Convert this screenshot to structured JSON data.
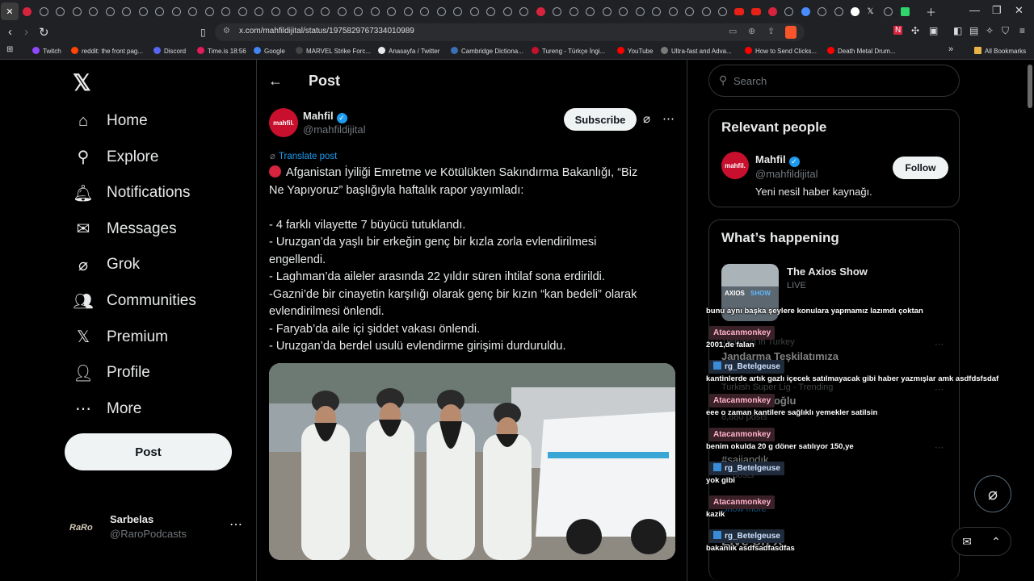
{
  "browser": {
    "url": "x.com/mahfildijital/status/1975829767334010989",
    "bookmarks": [
      "Twitch",
      "reddit: the front pag...",
      "Discord",
      "Time.is 18:56",
      "Google",
      "MARVEL Strike Forc...",
      "Anasayfa / Twitter",
      "Cambridge Dictiona...",
      "Tureng - Türkçe İngi...",
      "YouTube",
      "Ultra-fast and Adva...",
      "How to Send Clicks...",
      "Death Metal Drum..."
    ],
    "all_bookmarks": "All Bookmarks",
    "bookmark_colors": [
      "#9146ff",
      "#ff4500",
      "#5865f2",
      "#e41b5c",
      "#4285f4",
      "#444444",
      "#e7e9ea",
      "#3b6eb4",
      "#c8102e",
      "#ff0000",
      "#7a7a7a",
      "#ff0000",
      "#ff0000"
    ]
  },
  "nav": {
    "items": [
      {
        "label": "Home",
        "icon": "home-icon",
        "glyph": "⌂"
      },
      {
        "label": "Explore",
        "icon": "search-icon",
        "glyph": "⚲"
      },
      {
        "label": "Notifications",
        "icon": "bell-icon",
        "glyph": "🔔︎"
      },
      {
        "label": "Messages",
        "icon": "envelope-icon",
        "glyph": "✉"
      },
      {
        "label": "Grok",
        "icon": "grok-icon",
        "glyph": "⌀"
      },
      {
        "label": "Communities",
        "icon": "people-icon",
        "glyph": "👥︎"
      },
      {
        "label": "Premium",
        "icon": "x-icon",
        "glyph": "𝕏"
      },
      {
        "label": "Profile",
        "icon": "person-icon",
        "glyph": "👤︎"
      },
      {
        "label": "More",
        "icon": "more-circle-icon",
        "glyph": "⋯"
      }
    ],
    "post_button": "Post",
    "account": {
      "name": "Sarbelas",
      "handle": "@RaroPodcasts",
      "avatar_text": "RaRo"
    }
  },
  "main": {
    "title": "Post",
    "author": {
      "name": "Mahfil",
      "handle": "@mahfildijital",
      "avatar_text": "mahfil."
    },
    "subscribe": "Subscribe",
    "translate": "Translate post",
    "lines": [
      "Afganistan İyiliği Emretme ve Kötülükten Sakındırma Bakanlığı, “Biz",
      "Ne Yapıyoruz” başlığıyla haftalık rapor yayımladı:",
      "",
      "- 4 farklı vilayette 7 büyücü tutuklandı.",
      "- Uruzgan’da yaşlı bir erkeğin genç bir kızla zorla evlendirilmesi",
      "engellendi.",
      "- Laghman’da aileler arasında 22 yıldır süren ihtilaf sona erdirildi.",
      "-Gazni’de bir cinayetin karşılığı olarak genç bir kızın “kan bedeli” olarak",
      "evlendirilmesi önlendi.",
      "- Faryab’da aile içi şiddet vakası önlendi.",
      "- Uruzgan’da berdel usulü evlendirme girişimi durduruldu."
    ]
  },
  "right": {
    "search_placeholder": "Search",
    "relevant_title": "Relevant people",
    "person": {
      "name": "Mahfil",
      "handle": "@mahfildijital",
      "bio": "Yeni nesil haber kaynağı.",
      "follow": "Follow",
      "avatar_text": "mahfil."
    },
    "happening_title": "What’s happening",
    "axios": {
      "title": "The Axios Show",
      "status": "LIVE"
    },
    "ghost": {
      "trend1_context": "Trending in Turkey",
      "trend1": "Jandarma Teşkilatımıza",
      "trend2_context": "Turkish Super Lig · Trending",
      "trend2": "Erkoğlu",
      "trend2_posts": "8,880 posts",
      "trend3": "#saijandık",
      "trend3_posts": "posts",
      "show_more": "Show more",
      "section": "Live on X"
    }
  },
  "chat": [
    {
      "type": "msg",
      "text": "bunu aynı başka şeylere konulara yapmamız lazımdı çoktan"
    },
    {
      "type": "user",
      "name": "Atacanmonkey",
      "style": "pink"
    },
    {
      "type": "msg",
      "text": "2001,de falan"
    },
    {
      "type": "user",
      "name": "rg_Betelgeuse",
      "style": "blue"
    },
    {
      "type": "msg",
      "text": "kantinlerde artık gazlı içecek satılmayacak gibi haber yazmışlar amk asdfdsfsdaf"
    },
    {
      "type": "user",
      "name": "Atacanmonkey",
      "style": "pink"
    },
    {
      "type": "msg",
      "text": "eee o zaman kantilere sağlıklı yemekler satilsin"
    },
    {
      "type": "user",
      "name": "Atacanmonkey",
      "style": "pink"
    },
    {
      "type": "msg",
      "text": "benim okulda 20 g döner satılıyor 150,ye"
    },
    {
      "type": "user",
      "name": "rg_Betelgeuse",
      "style": "blue"
    },
    {
      "type": "msg",
      "text": "yok gibi"
    },
    {
      "type": "user",
      "name": "Atacanmonkey",
      "style": "pink"
    },
    {
      "type": "msg",
      "text": "kazik"
    },
    {
      "type": "user",
      "name": "rg_Betelgeuse",
      "style": "blue"
    },
    {
      "type": "msg",
      "text": "bakanlık asdfsadfasdfas"
    }
  ],
  "colors": {
    "accent": "#1d9bf0",
    "brand_red": "#c8102e",
    "background": "#000000"
  }
}
